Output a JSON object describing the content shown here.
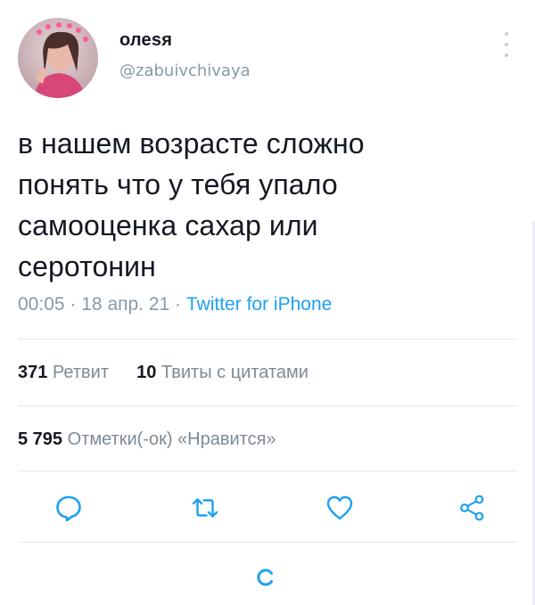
{
  "top_fragment": "...",
  "author": {
    "display_name": "олеsя",
    "handle": "@zabuivchivaya"
  },
  "tweet": {
    "text_lines": [
      "в нашем возрасте сложно",
      "понять что у тебя упало",
      "самооценка сахар или",
      "серотонин"
    ],
    "time": "00:05",
    "separator": "·",
    "date": "18 апр. 21",
    "source": "Twitter for iPhone"
  },
  "stats": {
    "retweets_count": "371",
    "retweets_label": "Ретвит",
    "quotes_count": "10",
    "quotes_label": "Твиты с цитатами",
    "likes_count": "5 795",
    "likes_label": "Отметки(-ок) «Нравится»"
  },
  "actions": {
    "icons": [
      "reply-icon",
      "retweet-icon",
      "like-icon",
      "share-icon"
    ],
    "color": "#1da1f2"
  },
  "colors": {
    "accent": "#1da1f2",
    "text": "#141823",
    "muted": "#8899a6"
  }
}
